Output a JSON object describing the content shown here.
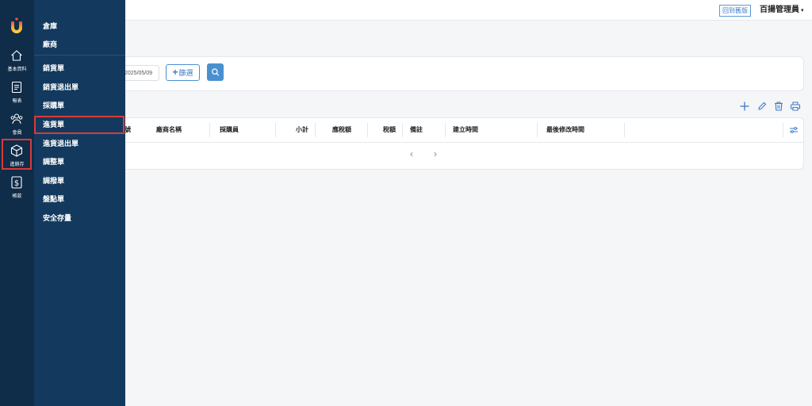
{
  "topbar": {
    "back_to_old": "回到舊版",
    "user_name": "百揚管理員",
    "caret": "▾"
  },
  "filters": {
    "date_value": "2025/05/09",
    "filter_plus": "+",
    "filter_label": "篩選",
    "search_icon": "search-icon"
  },
  "toolbar": {
    "icons": [
      "plus-icon",
      "pencil-icon",
      "trash-icon",
      "printer-icon"
    ],
    "accent_color": "#3a7bc8"
  },
  "table": {
    "columns": [
      "號",
      "廠商名稱",
      "採購員",
      "小計",
      "應稅額",
      "稅額",
      "備註",
      "建立時間",
      "最後修改時間"
    ],
    "settings_icon": "sliders-icon",
    "pager": {
      "prev": "‹",
      "next": "›"
    }
  },
  "rail": {
    "logo": "brand-logo",
    "items": [
      {
        "icon": "home-icon",
        "label": "基本資料"
      },
      {
        "icon": "document-icon",
        "label": "報表"
      },
      {
        "icon": "users-icon",
        "label": "會員"
      },
      {
        "icon": "box-icon",
        "label": "進銷存",
        "selected": true
      },
      {
        "icon": "dollar-icon",
        "label": "帳款"
      }
    ]
  },
  "flyout": {
    "items": [
      {
        "label": "倉庫"
      },
      {
        "label": "廠商"
      },
      {
        "label": "銷貨單"
      },
      {
        "label": "銷貨退出單"
      },
      {
        "label": "採購單"
      },
      {
        "label": "進貨單",
        "selected": true
      },
      {
        "label": "進貨退出單"
      },
      {
        "label": "調整單"
      },
      {
        "label": "調撥單"
      },
      {
        "label": "盤點單"
      },
      {
        "label": "安全存量"
      }
    ],
    "highlight_color": "#d93a3a"
  }
}
